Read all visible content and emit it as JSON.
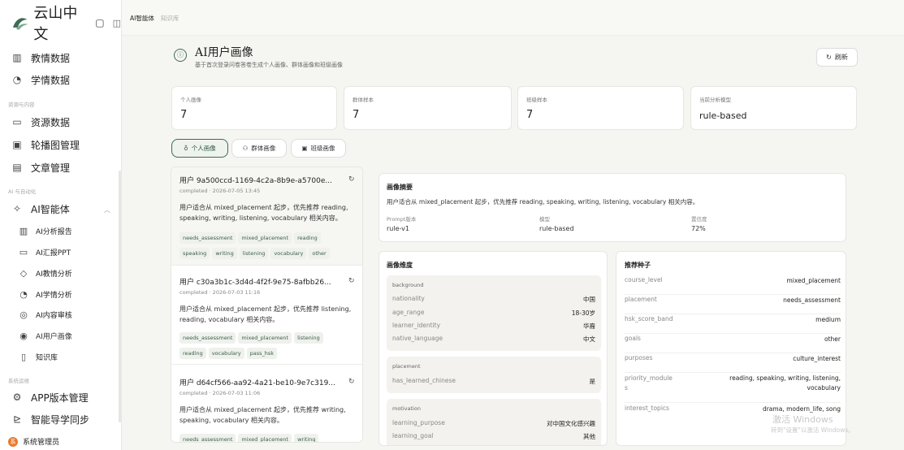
{
  "app": {
    "logo_text": "云山中文",
    "toggle_icon": "panel-toggle-icon"
  },
  "sidebar": {
    "items": [
      {
        "label": "教情数据",
        "icon": "bar-chart-icon"
      },
      {
        "label": "学情数据",
        "icon": "refresh-circle-icon"
      },
      {
        "label": "资源数据",
        "icon": "folder-icon"
      },
      {
        "label": "轮播图管理",
        "icon": "image-icon"
      },
      {
        "label": "文章管理",
        "icon": "document-icon"
      },
      {
        "label": "AI智能体",
        "icon": "sparkle-icon"
      },
      {
        "label": "APP版本管理",
        "icon": "gear-icon"
      },
      {
        "label": "智能导学同步",
        "icon": "sync-icon"
      }
    ],
    "groups": [
      "资源与内容",
      "AI 与自动化",
      "系统运维"
    ],
    "sub_items": [
      {
        "label": "AI分析报告",
        "icon": "bar-chart-icon"
      },
      {
        "label": "AI汇报PPT",
        "icon": "monitor-icon"
      },
      {
        "label": "AI教情分析",
        "icon": "shield-icon"
      },
      {
        "label": "AI学情分析",
        "icon": "refresh-circle-icon"
      },
      {
        "label": "AI内容审核",
        "icon": "check-shield-icon"
      },
      {
        "label": "AI用户画像",
        "icon": "user-circle-icon"
      },
      {
        "label": "知识库",
        "icon": "book-icon"
      }
    ],
    "user": {
      "label": "系统管理员",
      "avatar": "系"
    }
  },
  "breadcrumb": {
    "current": "AI智能体",
    "next": "知识库"
  },
  "header": {
    "title": "AI用户画像",
    "subtitle": "基于首次登录问卷答卷生成个人画像、群体画像和班级画像",
    "refresh_label": "刷新"
  },
  "stats": [
    {
      "label": "个人画像",
      "value": "7"
    },
    {
      "label": "群体样本",
      "value": "7"
    },
    {
      "label": "班级样本",
      "value": "7"
    },
    {
      "label": "当前分析模型",
      "value": "rule-based"
    }
  ],
  "tabs": [
    {
      "label": "个人画像",
      "icon": "person-icon"
    },
    {
      "label": "群体画像",
      "icon": "group-icon"
    },
    {
      "label": "班级画像",
      "icon": "class-icon"
    }
  ],
  "cards": [
    {
      "title": "用户 9a500ccd-1169-4c2a-8b9e-a5700e...",
      "meta": "completed · 2026-07-05 13:45",
      "desc": "用户适合从 mixed_placement 起步，优先推荐 reading, speaking, writing, listening, vocabulary 相关内容。",
      "tags_row1": [
        "needs_assessment",
        "mixed_placement",
        "reading"
      ],
      "tags_row2": [
        "speaking",
        "writing",
        "listening",
        "vocabulary",
        "other"
      ]
    },
    {
      "title": "用户 c30a3b1c-3d4d-4f2f-9e75-8afbb26...",
      "meta": "completed · 2026-07-03 11:16",
      "desc": "用户适合从 mixed_placement 起步，优先推荐 listening, reading, vocabulary 相关内容。",
      "tags_row1": [
        "needs_assessment",
        "mixed_placement",
        "listening"
      ],
      "tags_row2": [
        "reading",
        "vocabulary",
        "pass_hsk"
      ]
    },
    {
      "title": "用户 d64cf566-aa92-4a21-be10-9e7c319...",
      "meta": "completed · 2026-07-03 11:06",
      "desc": "用户适合从 mixed_placement 起步，优先推荐 writing, speaking, vocabulary 相关内容。",
      "tags_row1": [
        "needs_assessment",
        "mixed_placement",
        "writing"
      ],
      "tags_row2": []
    }
  ],
  "summary": {
    "title": "画像摘要",
    "text": "用户适合从 mixed_placement 起步，优先推荐 reading, speaking, writing, listening, vocabulary 相关内容。",
    "prompt_label": "Prompt版本",
    "prompt_value": "rule-v1",
    "model_label": "模型",
    "model_value": "rule-based",
    "conf_label": "置信度",
    "conf_value": "72%"
  },
  "dimensions": {
    "title": "画像维度",
    "background": {
      "header": "background",
      "rows": [
        {
          "k": "nationality",
          "v": "中国"
        },
        {
          "k": "age_range",
          "v": "18-30岁"
        },
        {
          "k": "learner_identity",
          "v": "华裔"
        },
        {
          "k": "native_language",
          "v": "中文"
        }
      ]
    },
    "placement": {
      "header": "placement",
      "rows": [
        {
          "k": "has_learned_chinese",
          "v": "是"
        }
      ]
    },
    "motivation": {
      "header": "motivation",
      "rows": [
        {
          "k": "learning_purpose",
          "v": "对中国文化感兴趣"
        },
        {
          "k": "learning_goal",
          "v": "其他"
        }
      ]
    }
  },
  "seeds": {
    "title": "推荐种子",
    "rows": [
      {
        "k": "course_level",
        "v": "mixed_placement"
      },
      {
        "k": "placement",
        "v": "needs_assessment"
      },
      {
        "k": "hsk_score_band",
        "v": "medium"
      },
      {
        "k": "goals",
        "v": "other"
      },
      {
        "k": "purposes",
        "v": "culture_interest"
      },
      {
        "k": "priority_module",
        "k2": "s",
        "v": "reading, speaking, writing, listening,",
        "v2": "vocabulary"
      },
      {
        "k": "interest_topics",
        "v": "drama, modern_life, song"
      }
    ]
  },
  "watermark": {
    "line1": "激活 Windows",
    "line2": "转到\"设置\"以激活 Windows。"
  }
}
